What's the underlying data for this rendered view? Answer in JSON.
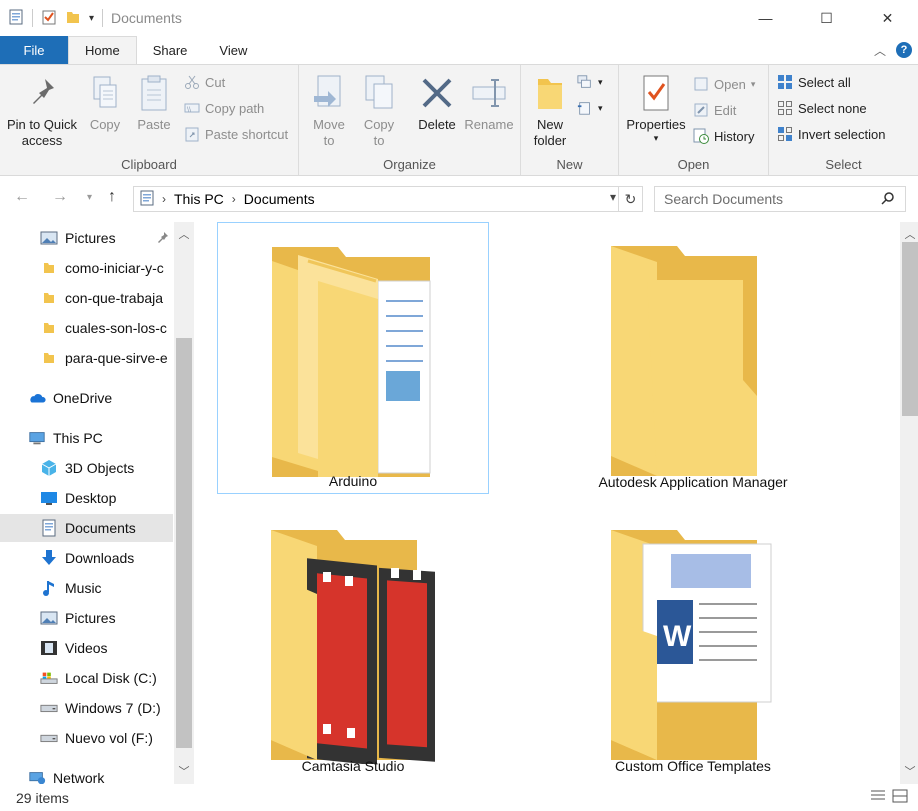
{
  "window": {
    "title": "Documents",
    "minimize": "—",
    "maximize": "☐",
    "close": "✕"
  },
  "tabs": [
    {
      "label": "File"
    },
    {
      "label": "Home"
    },
    {
      "label": "Share"
    },
    {
      "label": "View"
    }
  ],
  "ribbon": {
    "clipboard": {
      "label": "Clipboard",
      "pin_line1": "Pin to Quick",
      "pin_line2": "access",
      "copy": "Copy",
      "paste": "Paste",
      "cut": "Cut",
      "copy_path": "Copy path",
      "paste_shortcut": "Paste shortcut"
    },
    "organize": {
      "label": "Organize",
      "move_line1": "Move",
      "move_line2": "to",
      "copy_line1": "Copy",
      "copy_line2": "to",
      "delete": "Delete",
      "rename": "Rename"
    },
    "new": {
      "label": "New",
      "folder_line1": "New",
      "folder_line2": "folder"
    },
    "open": {
      "label": "Open",
      "properties": "Properties",
      "open": "Open",
      "edit": "Edit",
      "history": "History"
    },
    "select": {
      "label": "Select",
      "select_all": "Select all",
      "select_none": "Select none",
      "invert": "Invert selection"
    }
  },
  "address": {
    "crumbs": [
      "This PC",
      "Documents"
    ],
    "search_placeholder": "Search Documents"
  },
  "nav": {
    "items": [
      {
        "label": "Pictures",
        "icon": "pictures-icon"
      },
      {
        "label": "como-iniciar-y-c",
        "icon": "folder-icon"
      },
      {
        "label": "con-que-trabaja",
        "icon": "folder-icon"
      },
      {
        "label": "cuales-son-los-c",
        "icon": "folder-icon"
      },
      {
        "label": "para-que-sirve-e",
        "icon": "folder-icon"
      },
      {
        "label": "OneDrive",
        "icon": "onedrive-icon"
      },
      {
        "label": "This PC",
        "icon": "this-pc-icon"
      },
      {
        "label": "3D Objects",
        "icon": "3d-objects-icon"
      },
      {
        "label": "Desktop",
        "icon": "desktop-icon"
      },
      {
        "label": "Documents",
        "icon": "documents-icon"
      },
      {
        "label": "Downloads",
        "icon": "downloads-icon"
      },
      {
        "label": "Music",
        "icon": "music-icon"
      },
      {
        "label": "Pictures",
        "icon": "pictures-icon"
      },
      {
        "label": "Videos",
        "icon": "videos-icon"
      },
      {
        "label": "Local Disk (C:)",
        "icon": "local-disk-icon"
      },
      {
        "label": "Windows 7 (D:)",
        "icon": "drive-icon"
      },
      {
        "label": "Nuevo vol (F:)",
        "icon": "drive-icon"
      },
      {
        "label": "Network",
        "icon": "network-icon"
      }
    ]
  },
  "content": {
    "items": [
      {
        "label": "Arduino",
        "icon": "folder-with-document-icon"
      },
      {
        "label": "Autodesk Application Manager",
        "icon": "folder-icon"
      },
      {
        "label": "Camtasia Studio",
        "icon": "folder-with-film-icon"
      },
      {
        "label": "Custom Office Templates",
        "icon": "folder-with-word-document-icon"
      }
    ]
  },
  "status": {
    "count": "29 items"
  },
  "colors": {
    "accent": "#1e6eb7",
    "folder": "#f8d775",
    "folder_dark": "#e8b84a",
    "selection": "#cce8ff"
  }
}
